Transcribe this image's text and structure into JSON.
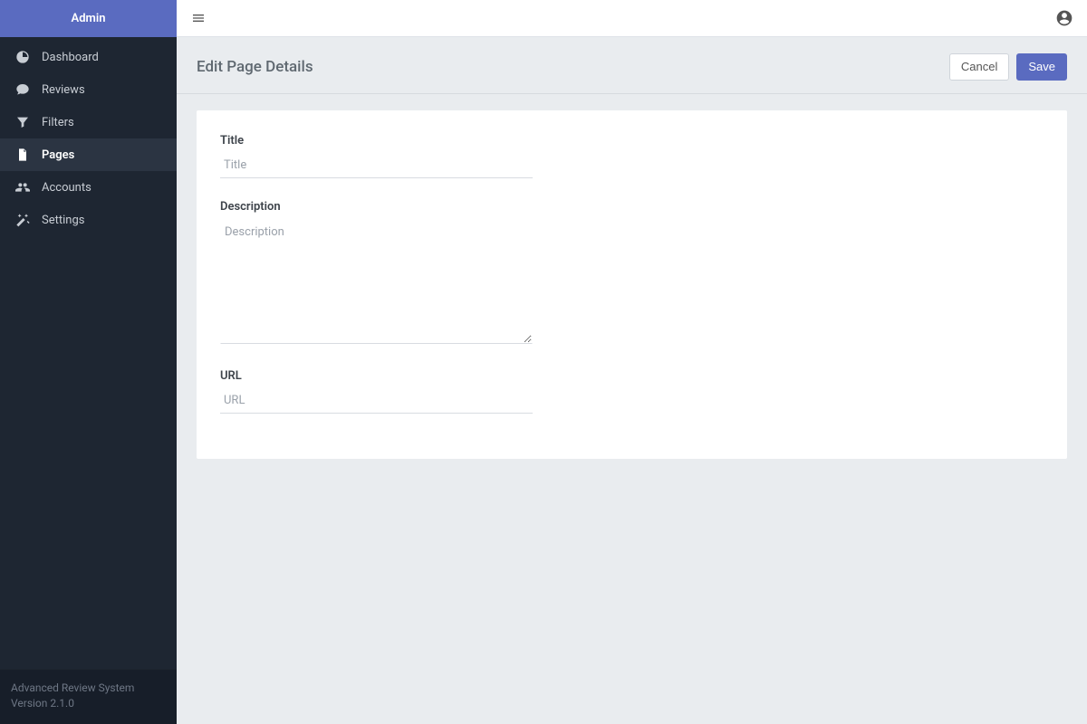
{
  "brand": "Admin",
  "sidebar": {
    "items": [
      {
        "icon": "dashboard-icon",
        "label": "Dashboard",
        "active": false
      },
      {
        "icon": "reviews-icon",
        "label": "Reviews",
        "active": false
      },
      {
        "icon": "filters-icon",
        "label": "Filters",
        "active": false
      },
      {
        "icon": "pages-icon",
        "label": "Pages",
        "active": true
      },
      {
        "icon": "accounts-icon",
        "label": "Accounts",
        "active": false
      },
      {
        "icon": "settings-icon",
        "label": "Settings",
        "active": false
      }
    ],
    "footer_line1": "Advanced Review System",
    "footer_line2": "Version 2.1.0"
  },
  "header": {
    "title": "Edit Page Details",
    "cancel_label": "Cancel",
    "save_label": "Save"
  },
  "form": {
    "title_label": "Title",
    "title_placeholder": "Title",
    "title_value": "",
    "description_label": "Description",
    "description_placeholder": "Description",
    "description_value": "",
    "url_label": "URL",
    "url_placeholder": "URL",
    "url_value": ""
  }
}
